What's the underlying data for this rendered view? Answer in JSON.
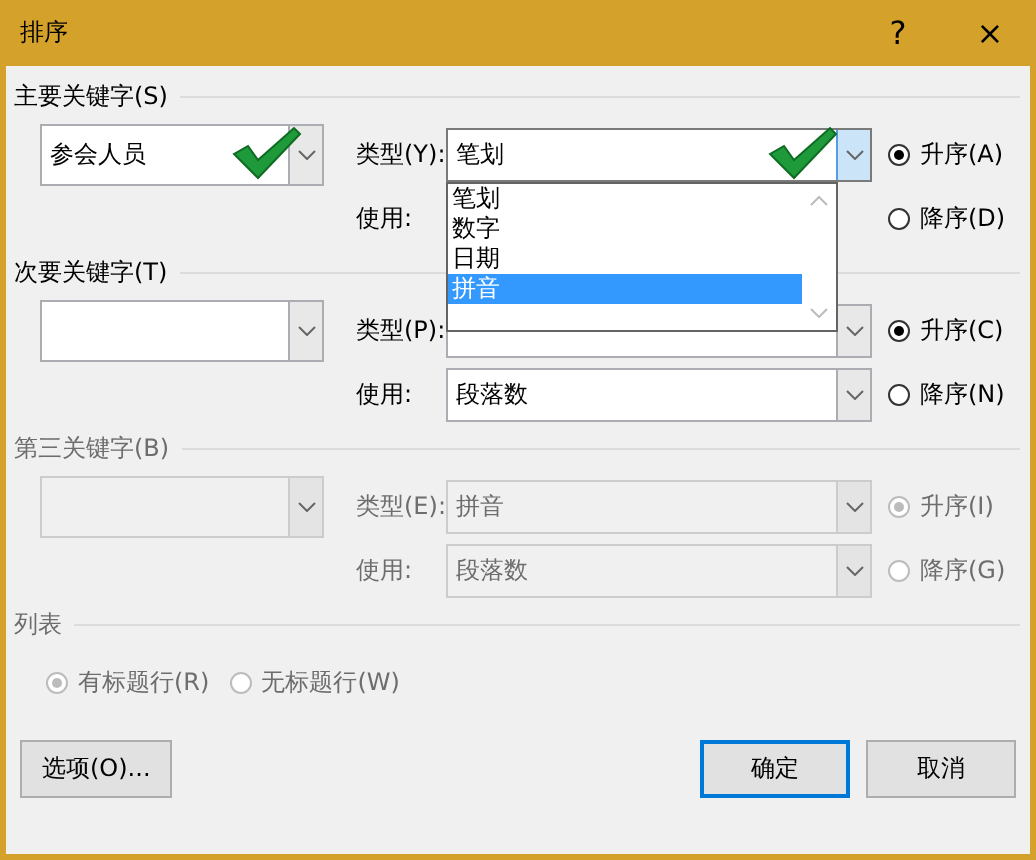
{
  "window": {
    "title": "排序",
    "help": "?",
    "close": "×"
  },
  "sort_keys": [
    {
      "label": "主要关键字(S)",
      "disabled": false,
      "key_value": "参会人员",
      "type_label": "类型(Y):",
      "type_value": "笔划",
      "type_focused": true,
      "use_label": "使用:",
      "dropdown": [
        {
          "label": "笔划",
          "selected": false
        },
        {
          "label": "数字",
          "selected": false
        },
        {
          "label": "日期",
          "selected": false
        },
        {
          "label": "拼音",
          "selected": true
        }
      ],
      "order": [
        {
          "label": "升序(A)",
          "selected": true
        },
        {
          "label": "降序(D)",
          "selected": false
        }
      ]
    },
    {
      "label": "次要关键字(T)",
      "disabled": false,
      "type_label": "类型(P):",
      "use_label": "使用:",
      "use_value": "段落数",
      "order": [
        {
          "label": "升序(C)",
          "selected": true
        },
        {
          "label": "降序(N)",
          "selected": false
        }
      ]
    },
    {
      "label": "第三关键字(B)",
      "disabled": true,
      "type_label": "类型(E):",
      "type_value": "拼音",
      "use_label": "使用:",
      "use_value": "段落数",
      "order": [
        {
          "label": "升序(I)",
          "selected": true
        },
        {
          "label": "降序(G)",
          "selected": false
        }
      ]
    }
  ],
  "list": {
    "label": "列表",
    "disabled": true,
    "options": [
      {
        "label": "有标题行(R)",
        "selected": true
      },
      {
        "label": "无标题行(W)",
        "selected": false
      }
    ]
  },
  "options_button": "选项(O)...",
  "buttons": [
    {
      "label": "确定",
      "default": true
    },
    {
      "label": "取消",
      "default": false
    }
  ]
}
